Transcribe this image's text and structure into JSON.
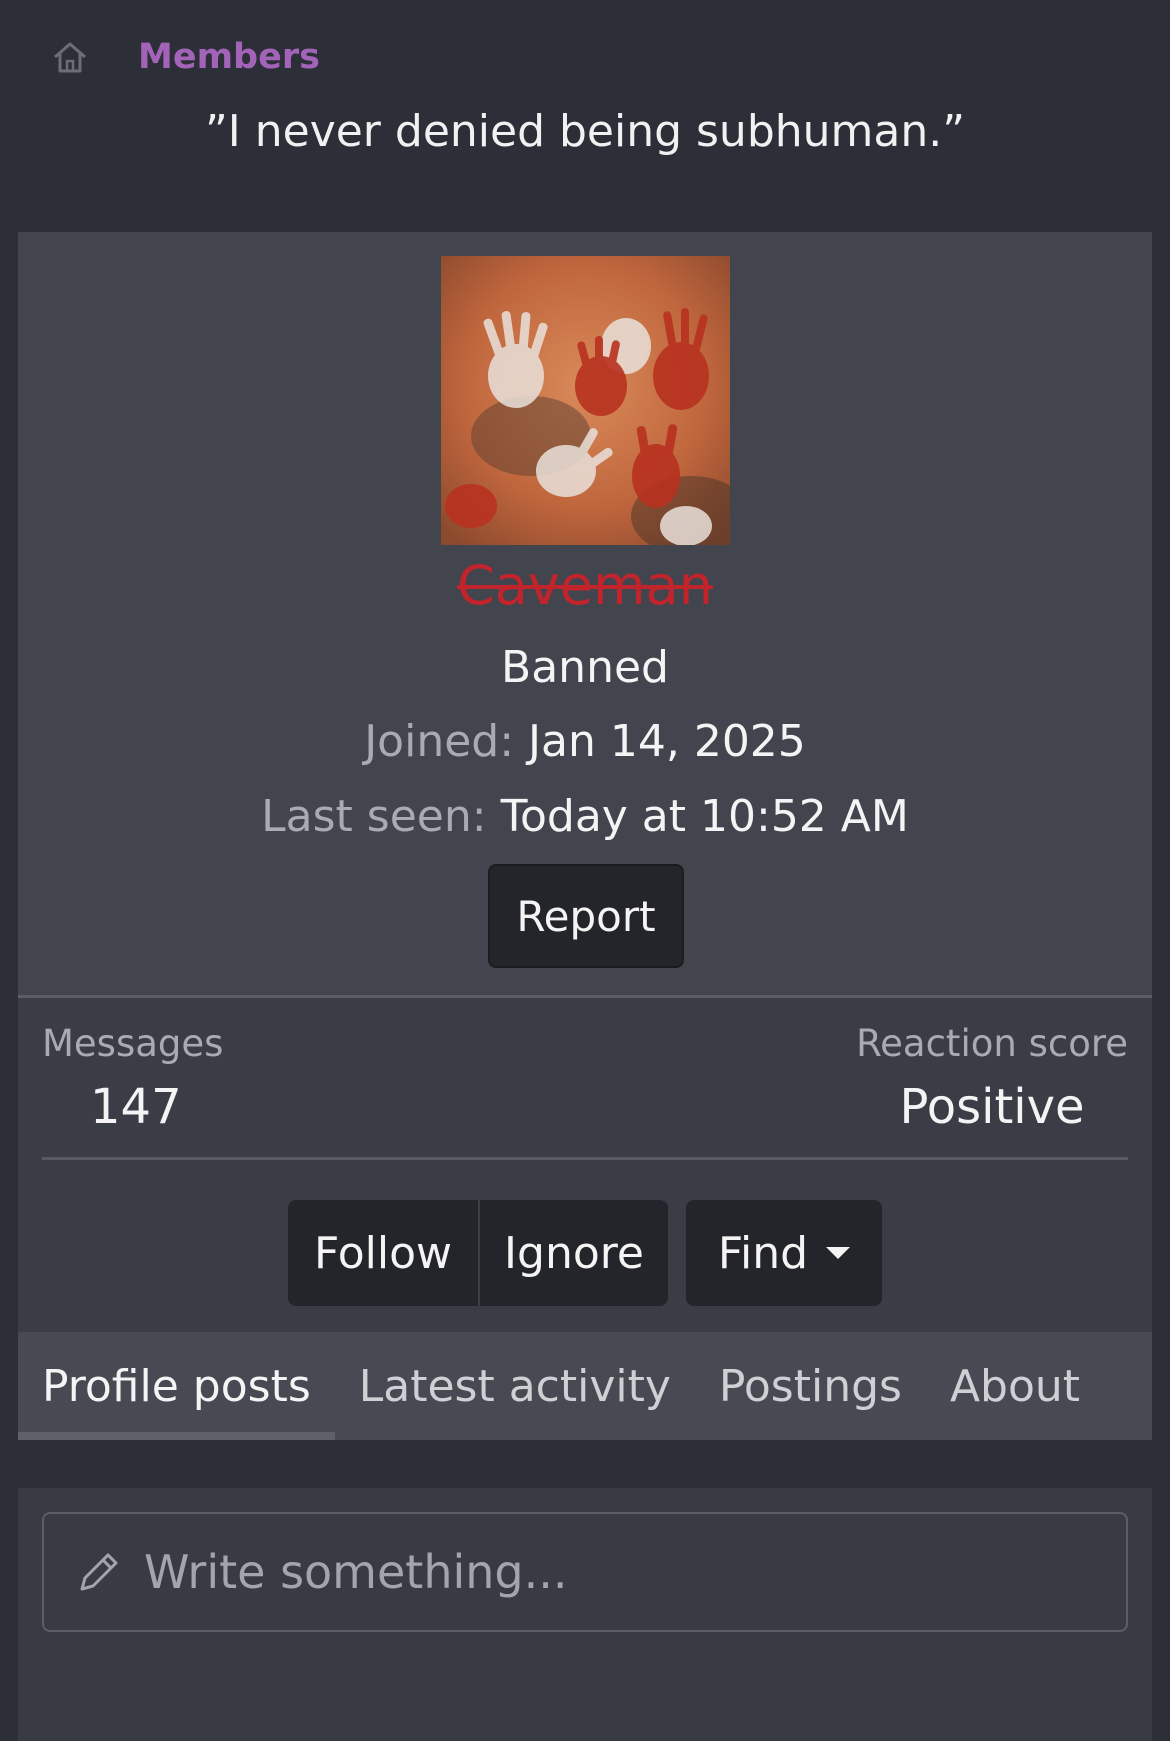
{
  "breadcrumb": {
    "home_icon": "home-icon",
    "link": "Members"
  },
  "profile": {
    "quote": "”I never denied being subhuman.”",
    "username": "Caveman",
    "status": "Banned",
    "joined_label": "Joined:",
    "joined_value": "Jan 14, 2025",
    "last_seen_label": "Last seen:",
    "last_seen_value": "Today at 10:52 AM",
    "report_label": "Report"
  },
  "stats": {
    "messages_label": "Messages",
    "messages_value": "147",
    "reaction_label": "Reaction score",
    "reaction_value": "Positive"
  },
  "actions": {
    "follow": "Follow",
    "ignore": "Ignore",
    "find": "Find"
  },
  "tabs": [
    {
      "label": "Profile posts",
      "active": true
    },
    {
      "label": "Latest activity",
      "active": false
    },
    {
      "label": "Postings",
      "active": false
    },
    {
      "label": "About",
      "active": false
    }
  ],
  "composer": {
    "placeholder": "Write something..."
  },
  "colors": {
    "accent": "#a363b8",
    "banned_name": "#c2242c",
    "background": "#2c2f37"
  }
}
